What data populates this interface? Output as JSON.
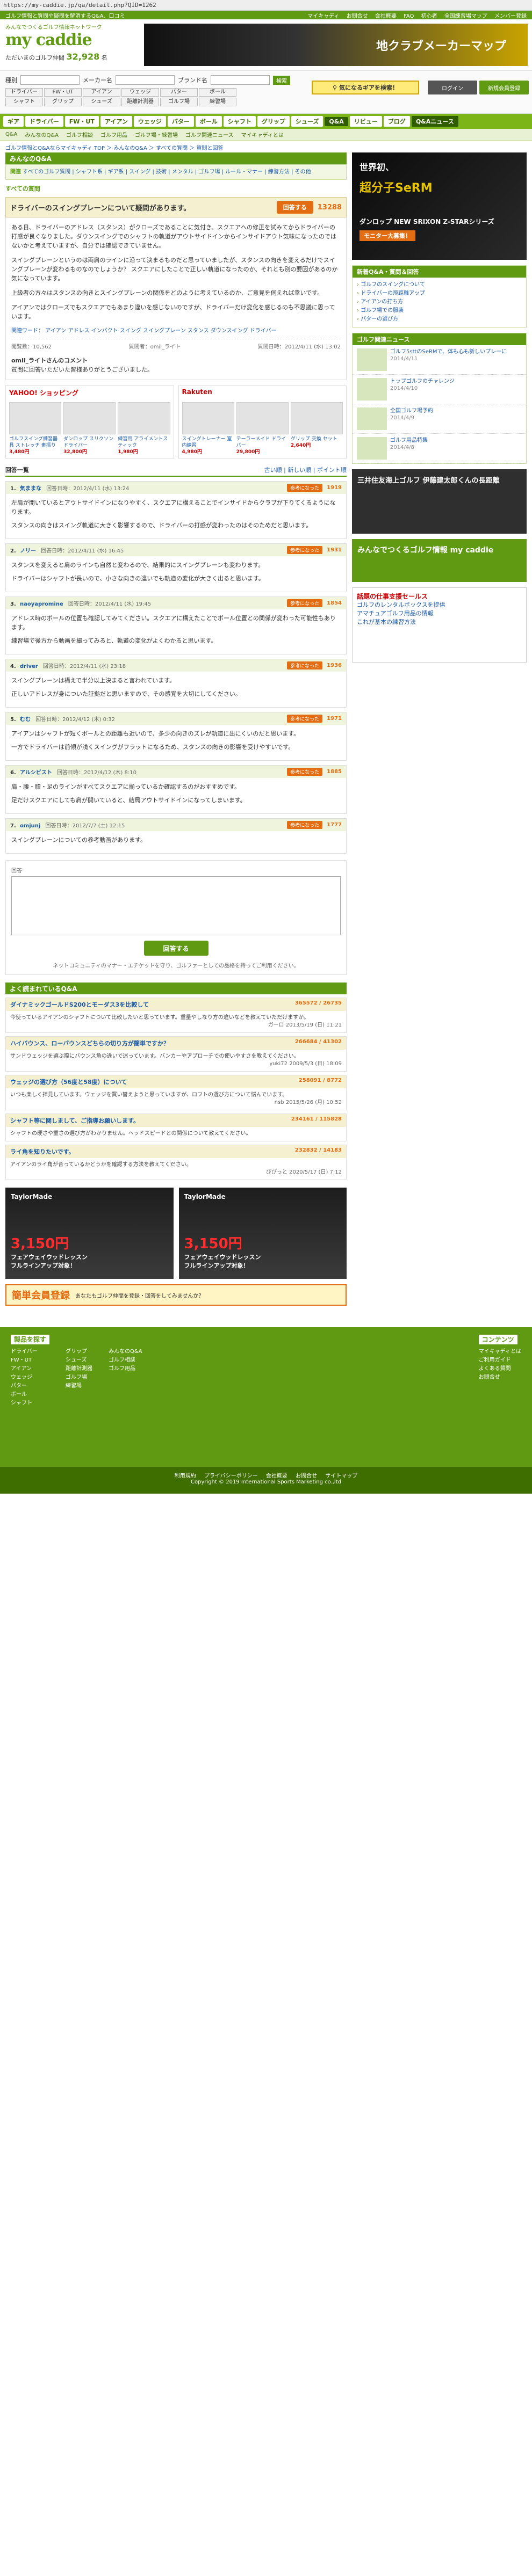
{
  "url": "https://my-caddie.jp/qa/detail.php?QID=1262",
  "topbar": {
    "left": "ゴルフ情報と質問や疑問を解消するQ&A、口コミ",
    "links": [
      "マイキャディ",
      "お問合せ",
      "会社概要",
      "FAQ",
      "初心者",
      "全国練習場マップ",
      "メンバー登録"
    ]
  },
  "header": {
    "logo": "my caddie",
    "logo_sub": "みんなでつくるゴルフ情報ネットワーク",
    "member_count_label": "ただいまのゴルフ仲間",
    "member_count": "32,928",
    "member_suffix": "名",
    "banner_text": "地クラブメーカーマップ"
  },
  "search": {
    "type_label": "種別",
    "maker_label": "メーカー名",
    "brand_label": "ブランド名",
    "go_label": "検索",
    "categories": [
      "ドライバー",
      "FW・UT",
      "アイアン",
      "ウェッジ",
      "パター",
      "ボール",
      "シャフト",
      "グリップ",
      "シューズ",
      "距離計測器",
      "ゴルフ場",
      "練習場"
    ],
    "keyword_button": "気になるギアを検索！",
    "login": "ログイン",
    "register": "新規会員登録"
  },
  "nav": {
    "items": [
      "ギア",
      "ドライバー",
      "FW・UT",
      "アイアン",
      "ウェッジ",
      "パター",
      "ボール",
      "シャフト",
      "グリップ",
      "シューズ",
      "Q&A",
      "リビュー",
      "ブログ",
      "Q&Aニュース"
    ],
    "sub": [
      "Q&A",
      "みんなのQ&A",
      "ゴルフ相談",
      "ゴルフ用品",
      "ゴルフ場・練習場",
      "ゴルフ関連ニュース",
      "マイキャディとは"
    ]
  },
  "breadcrumb": "ゴルフ情報とQ&Aならマイキャディ TOP ＞ みんなのQ&A ＞ すべての質問 ＞ 質問と回答",
  "section_title": "みんなのQ&A",
  "category_links": {
    "label": "関連",
    "text": "すべてのゴルフ質問 | シャフト系 | ギア系 | スイング | 技術 | メンタル | ゴルフ場 | ルール・マナー | 練習方法 | その他"
  },
  "question": {
    "kind": "すべての質問",
    "title": "ドライバーのスイングプレーンについて疑問があります。",
    "answer_button": "回答する",
    "points": "13288",
    "paragraphs": [
      "ある日、ドライバーのアドレス（スタンス）がクローズであることに気付き、スクエアへの修正を試みてからドライバーの打感が良くなりました。ダウンスイングでのシャフトの軌道がアウトサイドインからインサイドアウト気味になったのではないかと考えていますが、自分では確認できていません。",
      "スイングプレーンというのは両肩のラインに沿って決まるものだと思っていましたが、スタンスの向きを変えるだけでスイングプレーンが変わるものなのでしょうか？ スクエアにしたことで正しい軌道になったのか、それとも別の要因があるのか気になっています。",
      "上級者の方々はスタンスの向きとスイングプレーンの関係をどのように考えているのか、ご意見を伺えれば幸いです。",
      "アイアンではクローズでもスクエアでもあまり違いを感じないのですが、ドライバーだけ変化を感じるのも不思議に思っています。"
    ],
    "tags_label": "関連ワード：",
    "tags": [
      "アイアン",
      "アドレス",
      "インパクト",
      "スイング",
      "スイングプレーン",
      "スタンス",
      "ダウンスイング",
      "ドライバー"
    ],
    "questioner": "質問者：omil_ライト",
    "posted": "質問日時：2012/4/11 (水) 13:02",
    "views": "閲覧数：10,562"
  },
  "sponsor_note": "omil_ライトさんのコメント",
  "sponsor_sub": "質問に回答いただいた皆様ありがとうございました。",
  "ads": {
    "yahoo_title": "YAHOO! ショッピング",
    "rakuten_title": "Rakuten",
    "yahoo_items": [
      {
        "name": "ゴルフスイング練習器具 ストレッチ 素振り",
        "price": "3,480円"
      },
      {
        "name": "ダンロップ スリクソン ドライバー",
        "price": "32,800円"
      },
      {
        "name": "練習用 アライメントスティック",
        "price": "1,980円"
      }
    ],
    "rakuten_items": [
      {
        "name": "スイングトレーナー 室内練習",
        "price": "4,980円"
      },
      {
        "name": "テーラーメイド ドライバー",
        "price": "29,800円"
      },
      {
        "name": "グリップ 交換 セット",
        "price": "2,640円"
      }
    ]
  },
  "answers_head": {
    "label": "回答一覧",
    "sort": "古い順 | 新しい順 | ポイント順"
  },
  "answers": [
    {
      "num": "1.",
      "who": "気ままな",
      "date": "回答日時：2012/4/11 (水) 13:24",
      "good": "参考になった",
      "score": "1919",
      "paragraphs": [
        "左肩が開いているとアウトサイドインになりやすく、スクエアに構えることでインサイドからクラブが下りてくるようになります。",
        "スタンスの向きはスイング軌道に大きく影響するので、ドライバーの打感が変わったのはそのためだと思います。"
      ]
    },
    {
      "num": "2.",
      "who": "ノリー",
      "date": "回答日時：2012/4/11 (水) 16:45",
      "good": "参考になった",
      "score": "1931",
      "paragraphs": [
        "スタンスを変えると肩のラインも自然と変わるので、結果的にスイングプレーンも変わります。",
        "ドライバーはシャフトが長いので、小さな向きの違いでも軌道の変化が大きく出ると思います。"
      ]
    },
    {
      "num": "3.",
      "who": "naoyapromine",
      "date": "回答日時：2012/4/11 (水) 19:45",
      "good": "参考になった",
      "score": "1854",
      "paragraphs": [
        "アドレス時のボールの位置も確認してみてください。スクエアに構えたことでボール位置との関係が変わった可能性もあります。",
        "練習場で後方から動画を撮ってみると、軌道の変化がよくわかると思います。"
      ]
    },
    {
      "num": "4.",
      "who": "driver",
      "date": "回答日時：2012/4/11 (水) 23:18",
      "good": "参考になった",
      "score": "1936",
      "paragraphs": [
        "スイングプレーンは構えで半分以上決まると言われています。",
        "正しいアドレスが身についた証拠だと思いますので、その感覚を大切にしてください。"
      ]
    },
    {
      "num": "5.",
      "who": "むむ",
      "date": "回答日時：2012/4/12 (木) 0:32",
      "good": "参考になった",
      "score": "1971",
      "paragraphs": [
        "アイアンはシャフトが短くボールとの距離も近いので、多少の向きのズレが軌道に出にくいのだと思います。",
        "一方でドライバーは前傾が浅くスイングがフラットになるため、スタンスの向きの影響を受けやすいです。"
      ]
    },
    {
      "num": "6.",
      "who": "アルシビスト",
      "date": "回答日時：2012/4/12 (木) 8:10",
      "good": "参考になった",
      "score": "1885",
      "paragraphs": [
        "肩・腰・膝・足のラインがすべてスクエアに揃っているか確認するのがおすすめです。",
        "足だけスクエアにしても肩が開いていると、結局アウトサイドインになってしまいます。"
      ]
    },
    {
      "num": "7.",
      "who": "omjunj",
      "date": "回答日時：2012/7/7 (土) 12:15",
      "good": "参考になった",
      "score": "1777",
      "paragraphs": [
        "スイングプレーンについての参考動画があります。"
      ]
    }
  ],
  "form": {
    "label": "回答",
    "submit": "回答する",
    "note": "ネットコミュニティのマナー・エチケットを守り、ゴルファーとしての品格を持ってご利用ください。"
  },
  "related": {
    "title": "よく読まれているQ&A",
    "items": [
      {
        "title": "ダイナミックゴールドS200とモーダス3を比較して",
        "stat": "365572",
        "score": "26735",
        "body": "今使っているアイアンのシャフトについて比較したいと思っています。重量やしなり方の違いなどを教えていただけますか。",
        "by": "ガーロ 2013/5/19 (日) 11:21"
      },
      {
        "title": "ハイバウンス、ローバウンスどちらの切り方が簡単ですか？",
        "stat": "266684",
        "score": "41302",
        "body": "サンドウェッジを選ぶ際にバウンス角の違いで迷っています。バンカーやアプローチでの使いやすさを教えてください。",
        "by": "yuki72 2009/5/3 (日) 18:09"
      },
      {
        "title": "ウェッジの選び方（56度と58度）について",
        "stat": "258091",
        "score": "8772",
        "body": "いつも楽しく拝見しています。ウェッジを買い替えようと思っていますが、ロフトの選び方について悩んでいます。",
        "by": "nsb 2015/5/26 (月) 10:52"
      },
      {
        "title": "シャフト等に関しまして、ご指導お願いします。",
        "stat": "234161",
        "score": "115828",
        "body": "シャフトの硬さや重さの選び方がわかりません。ヘッドスピードとの関係について教えてください。",
        "by": ""
      },
      {
        "title": "ライ角を知りたいです。",
        "stat": "232832",
        "score": "14183",
        "body": "アイアンのライ角が合っているかどうかを確認する方法を教えてください。",
        "by": "びびっと 2020/5/17 (日) 7:12"
      }
    ]
  },
  "bottom_ads": [
    {
      "brand": "TaylorMade",
      "title": "フェアウェイウッドレッスン",
      "price": "3,150円",
      "sub": "フルラインアップ対象！"
    },
    {
      "brand": "TaylorMade",
      "title": "フェアウェイウッドレッスン",
      "price": "3,150円",
      "sub": "フルラインアップ対象！"
    }
  ],
  "reg_banner": {
    "big": "簡単会員登録",
    "small": "あなたもゴルフ仲間を登録・回答をしてみませんか？"
  },
  "sidebar": {
    "banner": {
      "t1": "世界初、",
      "t2": "超分子SeRM",
      "t3": "ダンロップ NEW SRIXON Z-STARシリーズ",
      "t4": "モニター大募集！"
    },
    "news_title": "新着Q&A・質問＆回答",
    "news": [
      "ゴルフのスイングについて",
      "ドライバーの飛距離アップ",
      "アイアンの打ち方",
      "ゴルフ場での服装",
      "パターの選び方"
    ],
    "info_title": "ゴルフ関連ニュース",
    "info": [
      {
        "t": "ゴルフ5sttのSeRMで、体も心も新しいプレーに",
        "d": "2014/4/11"
      },
      {
        "t": "トップゴルフのチャレンジ",
        "d": "2014/4/10"
      },
      {
        "t": "全国ゴルフ場予約",
        "d": "2014/4/9"
      },
      {
        "t": "ゴルフ用品特集",
        "d": "2014/4/8"
      }
    ],
    "ad1": "三井住友海上ゴルフ 伊藤建太郎くんの長距離",
    "ad2": "みんなでつくるゴルフ情報 my caddie",
    "ad3_red": "話題の仕事支援セールス",
    "ad3": [
      "ゴルフのレンタルボックスを提供",
      "アマチュアゴルフ用品の情報",
      "これが基本の練習方法"
    ]
  },
  "footer": {
    "cols": [
      {
        "h": "製品を探す",
        "items": [
          "ドライバー",
          "FW・UT",
          "アイアン",
          "ウェッジ",
          "パター",
          "ボール",
          "シャフト"
        ]
      },
      {
        "h": "",
        "items": [
          "グリップ",
          "シューズ",
          "距離計測器",
          "ゴルフ場",
          "練習場"
        ]
      },
      {
        "h": "",
        "items": [
          "みんなのQ&A",
          "ゴルフ相談",
          "ゴルフ用品"
        ]
      },
      {
        "h": "コンテンツ",
        "items": [
          "マイキャディとは",
          "ご利用ガイド",
          "よくある質問",
          "お問合せ"
        ]
      }
    ],
    "bottom_links": [
      "利用規約",
      "プライバシーポリシー",
      "会社概要",
      "お問合せ",
      "サイトマップ"
    ],
    "copyright": "Copyright © 2019 International Sports Marketing co.,ltd"
  },
  "colors": {
    "brand_green": "#5f9a12",
    "accent_orange": "#e26d12"
  }
}
